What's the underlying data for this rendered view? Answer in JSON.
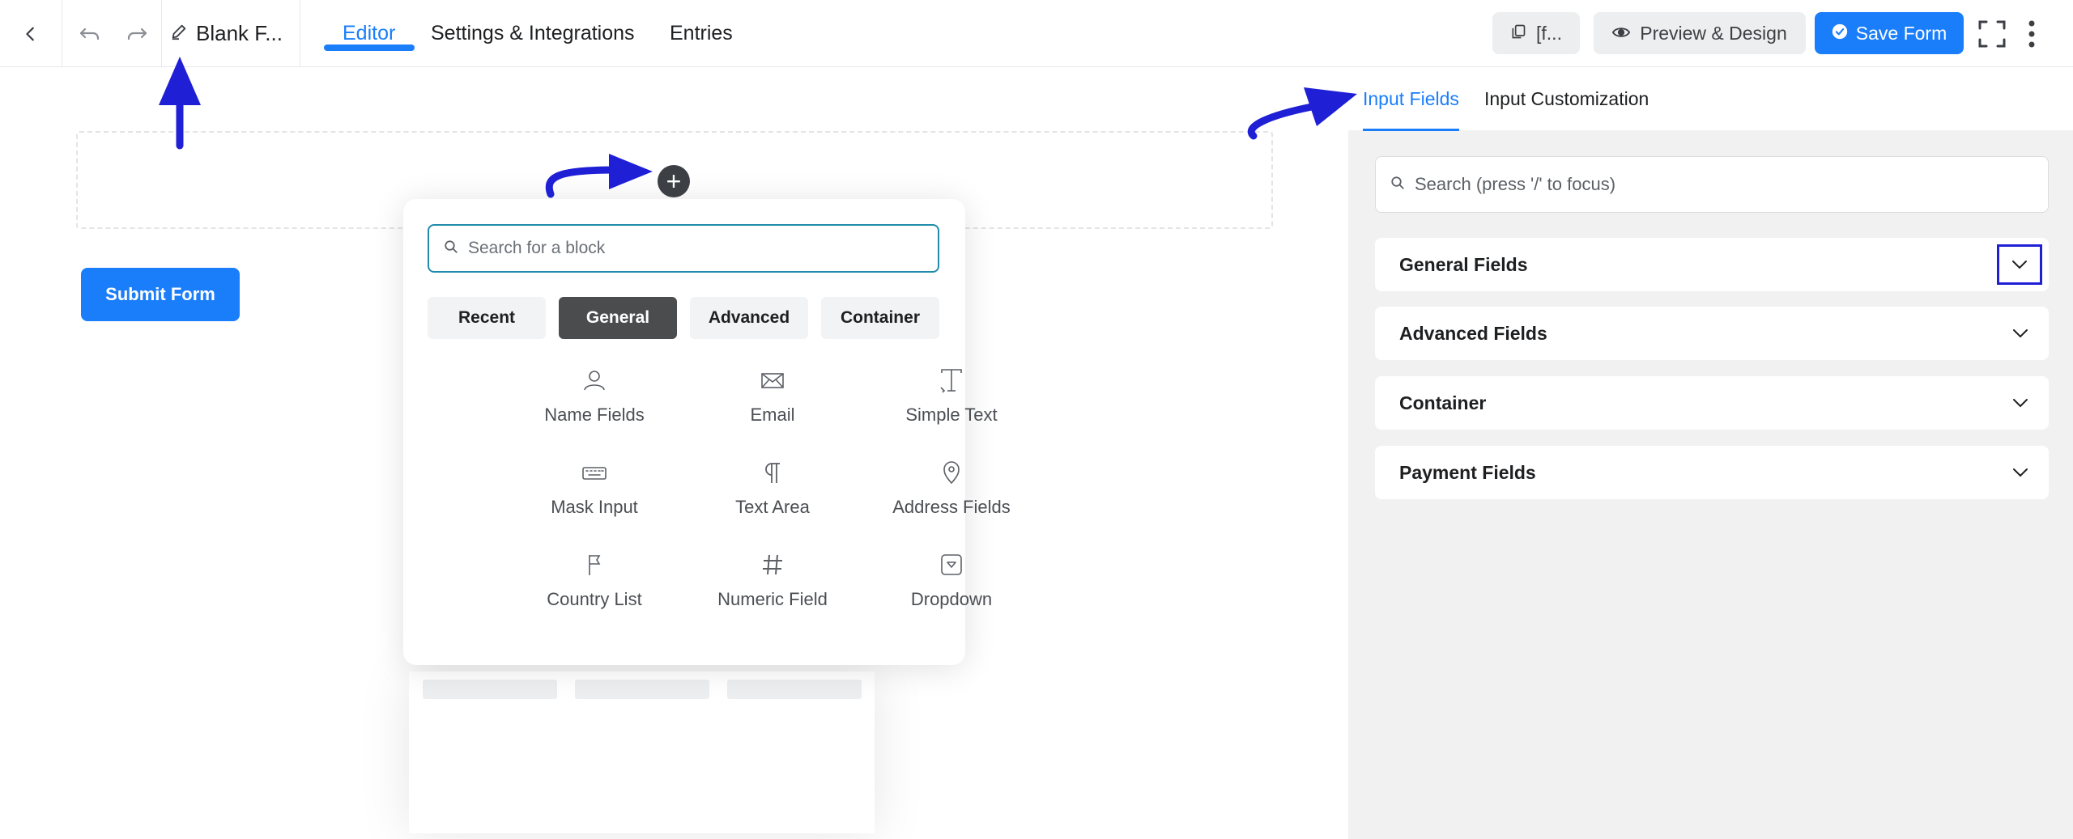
{
  "header": {
    "form_title": "Blank F...",
    "tabs": [
      {
        "label": "Editor",
        "active": true
      },
      {
        "label": "Settings & Integrations",
        "active": false
      },
      {
        "label": "Entries",
        "active": false
      }
    ],
    "shortcode_label": "[f...",
    "preview_label": "Preview & Design",
    "save_label": "Save Form"
  },
  "editor": {
    "submit_label": "Submit Form"
  },
  "inserter": {
    "search_placeholder": "Search for a block",
    "categories": [
      {
        "label": "Recent",
        "active": false
      },
      {
        "label": "General",
        "active": true
      },
      {
        "label": "Advanced",
        "active": false
      },
      {
        "label": "Container",
        "active": false
      }
    ],
    "blocks": [
      {
        "label": "Name Fields",
        "icon": "person-icon"
      },
      {
        "label": "Email",
        "icon": "envelope-icon"
      },
      {
        "label": "Simple Text",
        "icon": "text-cursor-icon"
      },
      {
        "label": "Mask Input",
        "icon": "keyboard-icon"
      },
      {
        "label": "Text Area",
        "icon": "pilcrow-icon"
      },
      {
        "label": "Address Fields",
        "icon": "map-pin-icon"
      },
      {
        "label": "Country List",
        "icon": "flag-icon"
      },
      {
        "label": "Numeric Field",
        "icon": "hash-icon"
      },
      {
        "label": "Dropdown",
        "icon": "dropdown-icon"
      }
    ]
  },
  "sidebar": {
    "tabs": [
      {
        "label": "Input Fields",
        "active": true
      },
      {
        "label": "Input Customization",
        "active": false
      }
    ],
    "search_placeholder": "Search (press '/' to focus)",
    "sections": [
      {
        "label": "General Fields"
      },
      {
        "label": "Advanced Fields"
      },
      {
        "label": "Container"
      },
      {
        "label": "Payment Fields"
      }
    ]
  },
  "colors": {
    "accent": "#1a7efb",
    "annotation": "#1f1fd6",
    "sidebar_bg": "#f1f1f1"
  }
}
